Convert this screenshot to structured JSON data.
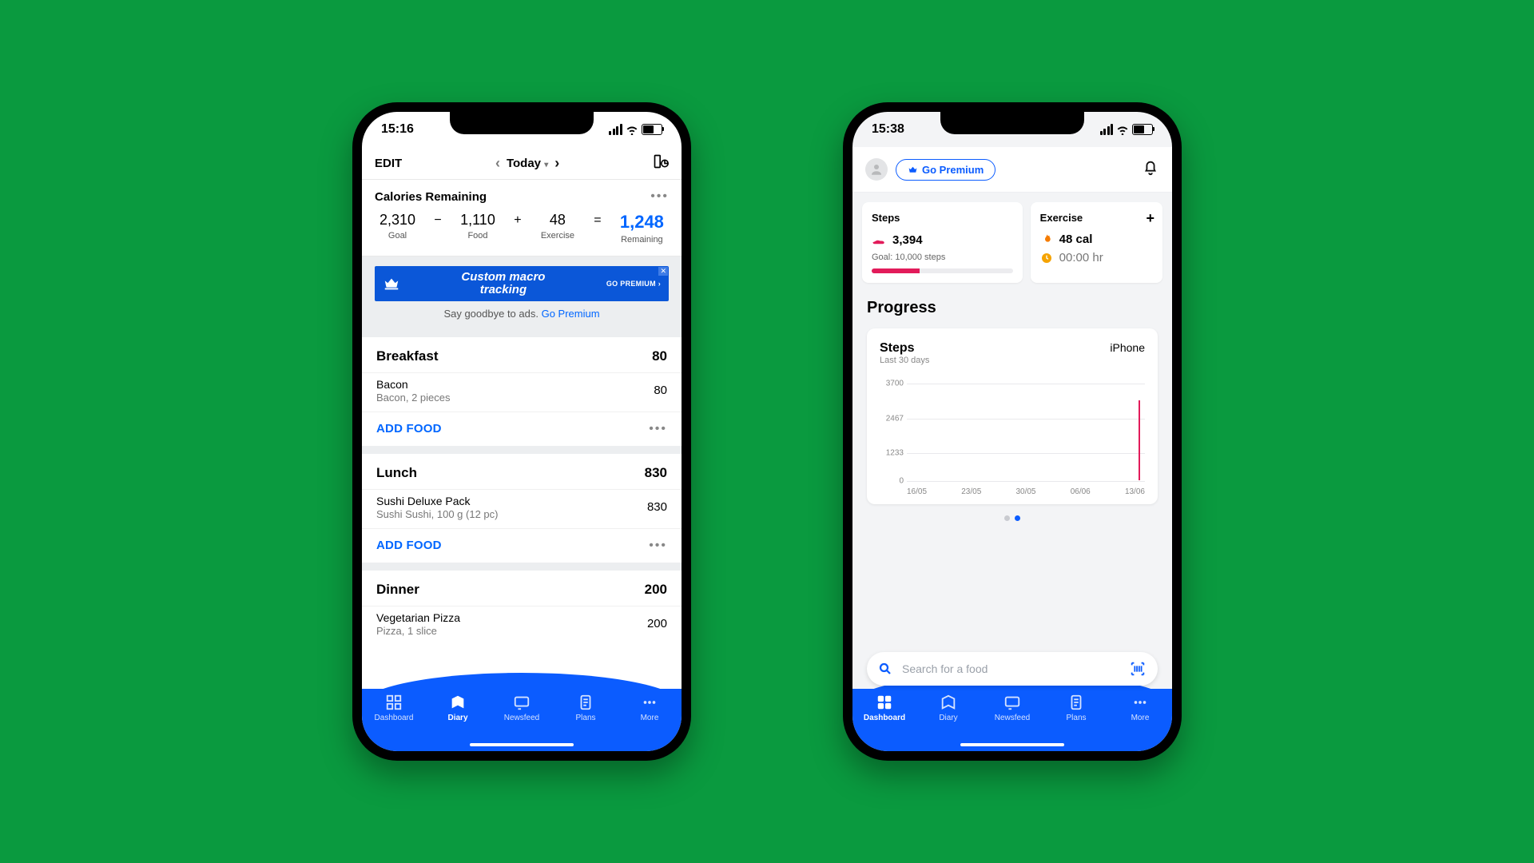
{
  "phone1": {
    "status_time": "15:16",
    "topbar": {
      "edit": "EDIT",
      "title": "Today"
    },
    "calories": {
      "title": "Calories Remaining",
      "goal": {
        "value": "2,310",
        "label": "Goal"
      },
      "food": {
        "value": "1,110",
        "label": "Food"
      },
      "ex": {
        "value": "48",
        "label": "Exercise"
      },
      "rem": {
        "value": "1,248",
        "label": "Remaining"
      }
    },
    "banner": {
      "line1": "Custom macro",
      "line2": "tracking",
      "cta": "GO PREMIUM"
    },
    "adline_text": "Say goodbye to ads. ",
    "adline_link": "Go Premium",
    "meals": [
      {
        "name": "Breakfast",
        "total": "80",
        "item": {
          "title": "Bacon",
          "desc": "Bacon, 2 pieces",
          "cal": "80"
        }
      },
      {
        "name": "Lunch",
        "total": "830",
        "item": {
          "title": "Sushi Deluxe Pack",
          "desc": "Sushi Sushi, 100 g (12 pc)",
          "cal": "830"
        }
      },
      {
        "name": "Dinner",
        "total": "200",
        "item": {
          "title": "Vegetarian Pizza",
          "desc": "Pizza, 1 slice",
          "cal": "200"
        }
      }
    ],
    "add_food": "ADD FOOD",
    "tabs": [
      "Dashboard",
      "Diary",
      "Newsfeed",
      "Plans",
      "More"
    ],
    "active_tab": 1
  },
  "phone2": {
    "status_time": "15:38",
    "go_premium": "Go Premium",
    "steps_card": {
      "title": "Steps",
      "value": "3,394",
      "goal": "Goal: 10,000 steps"
    },
    "ex_card": {
      "title": "Exercise",
      "cal": "48 cal",
      "time": "00:00 hr"
    },
    "progress_title": "Progress",
    "chart": {
      "title": "Steps",
      "subtitle": "Last 30 days",
      "device": "iPhone",
      "yticks": [
        "3700",
        "2467",
        "1233",
        "0"
      ],
      "xticks": [
        "16/05",
        "23/05",
        "30/05",
        "06/06",
        "13/06"
      ]
    },
    "search_placeholder": "Search for a food",
    "tabs": [
      "Dashboard",
      "Diary",
      "Newsfeed",
      "Plans",
      "More"
    ],
    "active_tab": 0
  },
  "chart_data": {
    "type": "bar",
    "title": "Steps",
    "subtitle": "Last 30 days",
    "device": "iPhone",
    "x": [
      "16/05",
      "23/05",
      "30/05",
      "06/06",
      "13/06"
    ],
    "series": [
      {
        "name": "Steps",
        "values": [
          0,
          0,
          0,
          0,
          3394
        ]
      }
    ],
    "ylim": [
      0,
      3700
    ],
    "yticks": [
      0,
      1233,
      2467,
      3700
    ],
    "xlabel": "",
    "ylabel": ""
  }
}
